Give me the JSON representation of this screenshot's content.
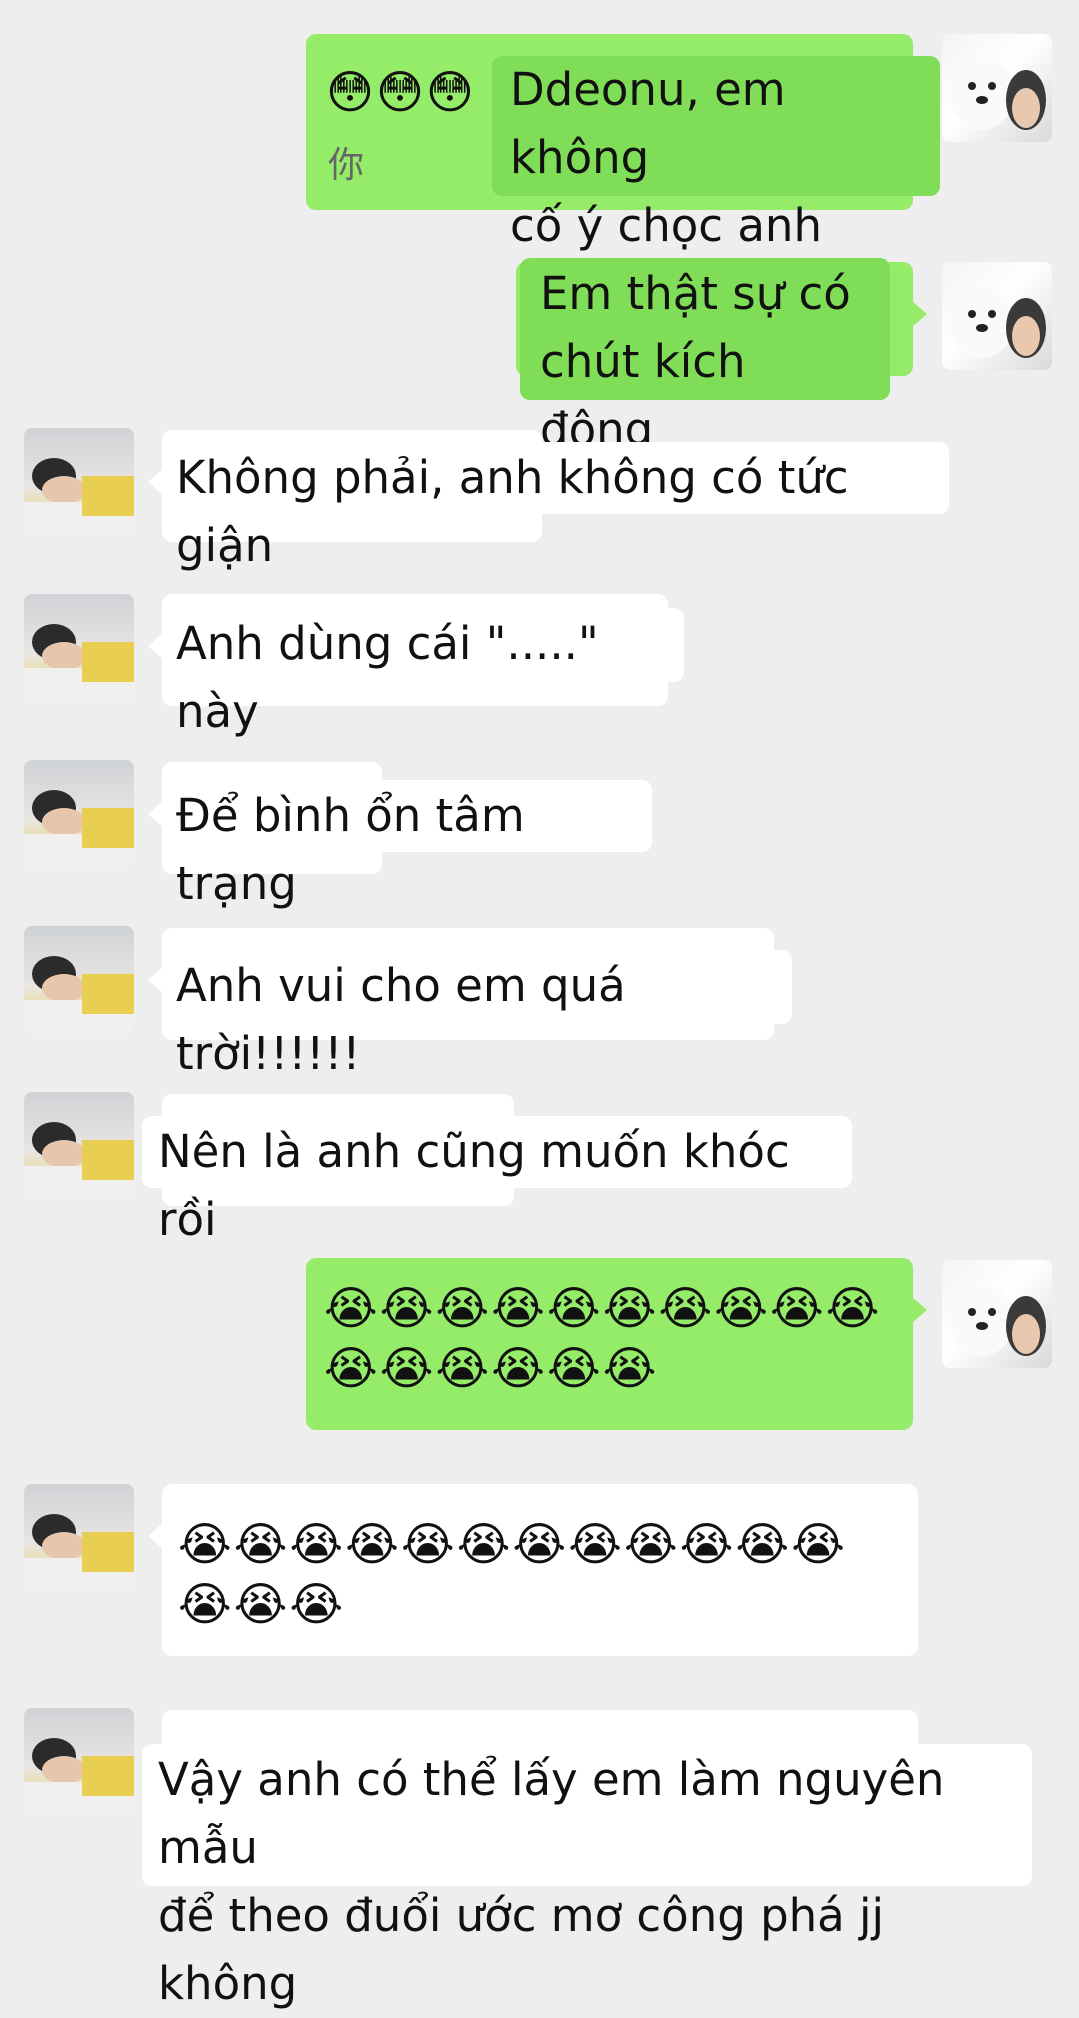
{
  "avatars": {
    "self": "dog-and-person-avatar",
    "other": "sleeping-boy-avatar"
  },
  "messages": [
    {
      "side": "right",
      "line1_emoji": "😳😳😳",
      "line2_cn": "你",
      "overlay": "Ddeonu, em không\ncố ý chọc anh"
    },
    {
      "side": "right",
      "overlay": "Em thật sự có\nchút kích động"
    },
    {
      "side": "left",
      "text": "Không phải, anh không có tức giận"
    },
    {
      "side": "left",
      "text": "Anh dùng cái \".....\" này"
    },
    {
      "side": "left",
      "text": "Để bình ổn tâm trạng"
    },
    {
      "side": "left",
      "text": "Anh vui cho em quá trời!!!!!!"
    },
    {
      "side": "left",
      "text": "Nên là anh cũng muốn khóc rồi"
    },
    {
      "side": "right",
      "emoji_line1": "😭😭😭😭😭😭😭😭😭😭",
      "emoji_line2": "😭😭😭😭😭😭"
    },
    {
      "side": "left",
      "emoji_line1": "😭😭😭😭😭😭😭😭😭😭😭😭",
      "emoji_line2": "😭😭😭"
    },
    {
      "side": "left",
      "text": "Vậy anh có thể lấy em làm nguyên mẫu\nđể theo đuổi ước mơ công phá jj không"
    }
  ],
  "colors": {
    "background": "#eeeeee",
    "sent_bubble": "#95ec69",
    "received_bubble": "#ffffff"
  }
}
